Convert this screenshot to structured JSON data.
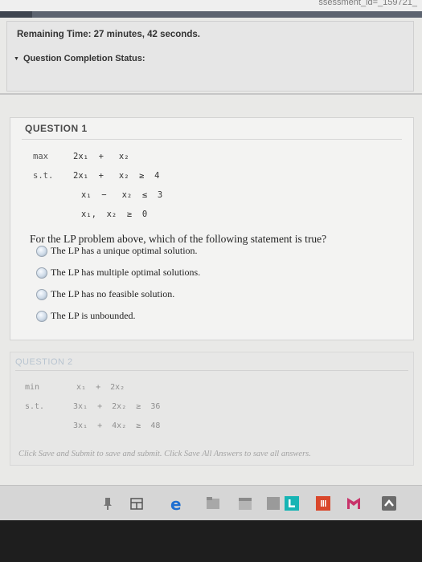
{
  "browser": {
    "url_fragment": "ssessment_id=_159721_"
  },
  "status": {
    "remaining_time": "Remaining Time: 27 minutes, 42 seconds.",
    "completion_label": "Question Completion Status:"
  },
  "question1": {
    "title": "QUESTION 1",
    "lp": {
      "max_kw": "max",
      "max_expr": "2x₁  +   x₂",
      "st_kw": "s.t.",
      "c1": "2x₁  +   x₂  ≥  4",
      "c2": "x₁  −   x₂  ≤  3",
      "c3": "x₁,  x₂  ≥  0"
    },
    "prompt": "For the LP problem above, which of the following statement is true?",
    "options": [
      "The LP has a unique optimal solution.",
      "The LP has multiple optimal solutions.",
      "The LP has no feasible solution.",
      "The LP is unbounded."
    ]
  },
  "question2": {
    "title": "QUESTION 2",
    "lp": {
      "min_kw": "min",
      "min_expr": "x₁  +  2x₂",
      "st_kw": "s.t.",
      "c1": "3x₁  +  2x₂  ≥  36",
      "c2": "3x₁  +  4x₂  ≥  48"
    }
  },
  "footer": {
    "note": "Click Save and Submit to save and submit. Click Save All Answers to save all answers."
  },
  "taskbar": {
    "icons": [
      "pin-icon",
      "store-icon",
      "edge-icon",
      "files-icon",
      "calendar-icon",
      "app-tile-icon",
      "linkedin-icon",
      "office-icon",
      "mcafee-icon",
      "send-icon"
    ]
  },
  "colors": {
    "edge_blue": "#1f6fd1",
    "linkedin_teal": "#17b4b4",
    "office_red": "#d9472b",
    "mcafee_pink": "#c8336a",
    "send_gray": "#6b6b6b"
  }
}
